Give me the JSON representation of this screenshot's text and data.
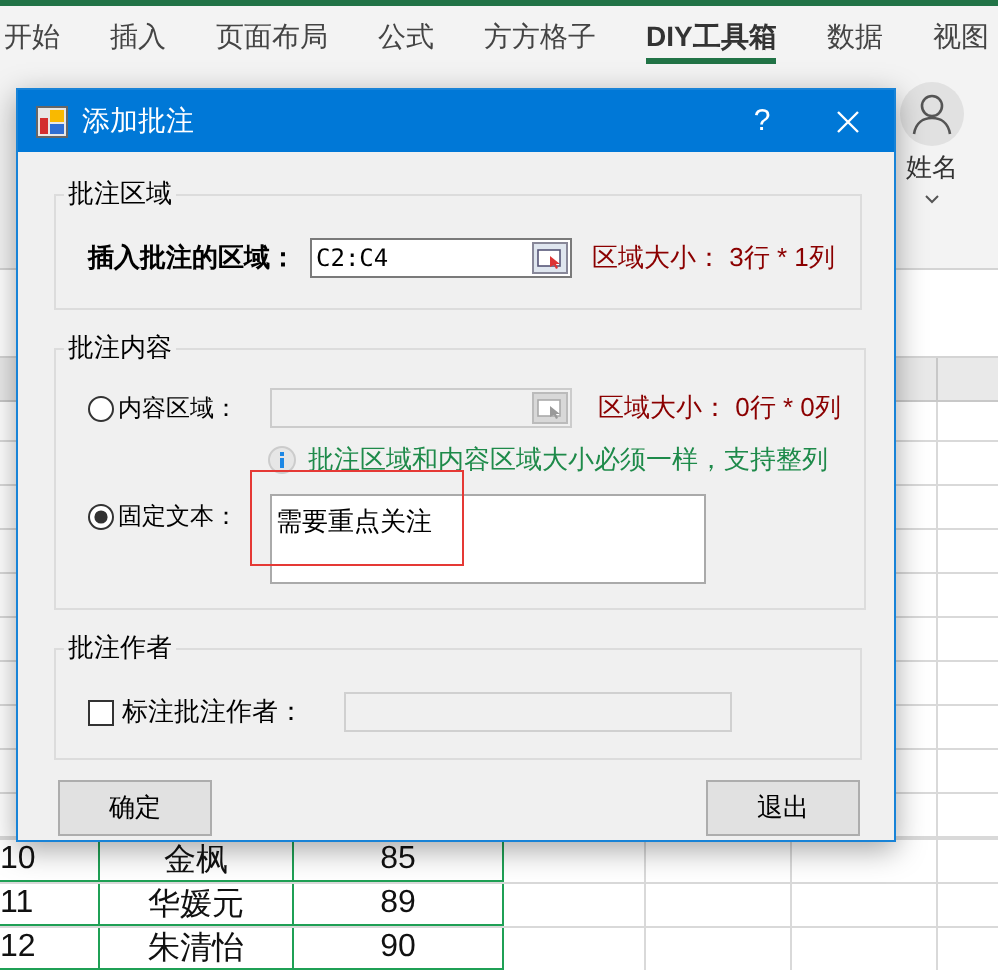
{
  "ribbon": {
    "tabs": [
      {
        "label": "开始",
        "selected": false
      },
      {
        "label": "插入",
        "selected": false
      },
      {
        "label": "页面布局",
        "selected": false
      },
      {
        "label": "公式",
        "selected": false
      },
      {
        "label": "方方格子",
        "selected": false
      },
      {
        "label": "DIY工具箱",
        "selected": true
      },
      {
        "label": "数据",
        "selected": false
      },
      {
        "label": "视图",
        "selected": false
      }
    ],
    "account_label": "姓名"
  },
  "dialog": {
    "title": "添加批注",
    "help_button": "?",
    "range_group": {
      "legend": "批注区域",
      "label": "插入批注的区域：",
      "value": "C2:C4",
      "size_text": "区域大小： 3行 * 1列"
    },
    "content_group": {
      "legend": "批注内容",
      "hint": "批注区域和内容区域大小必须一样，支持整列",
      "options": [
        {
          "kind": "range",
          "label": "内容区域：",
          "selected": false,
          "disabled": true,
          "size_text": "区域大小： 0行 * 0列"
        },
        {
          "kind": "text",
          "label": "固定文本：",
          "selected": true,
          "value": "需要重点关注"
        }
      ]
    },
    "author_group": {
      "legend": "批注作者",
      "label": "标注批注作者：",
      "checked": false
    },
    "buttons": [
      {
        "label": "确定"
      },
      {
        "label": "退出"
      }
    ]
  },
  "sheet": {
    "rows": [
      {
        "cells": [
          "10",
          "金枫",
          "85"
        ]
      },
      {
        "cells": [
          "11",
          "华媛元",
          "89"
        ]
      },
      {
        "cells": [
          "12",
          "朱清怡",
          "90"
        ]
      }
    ]
  }
}
